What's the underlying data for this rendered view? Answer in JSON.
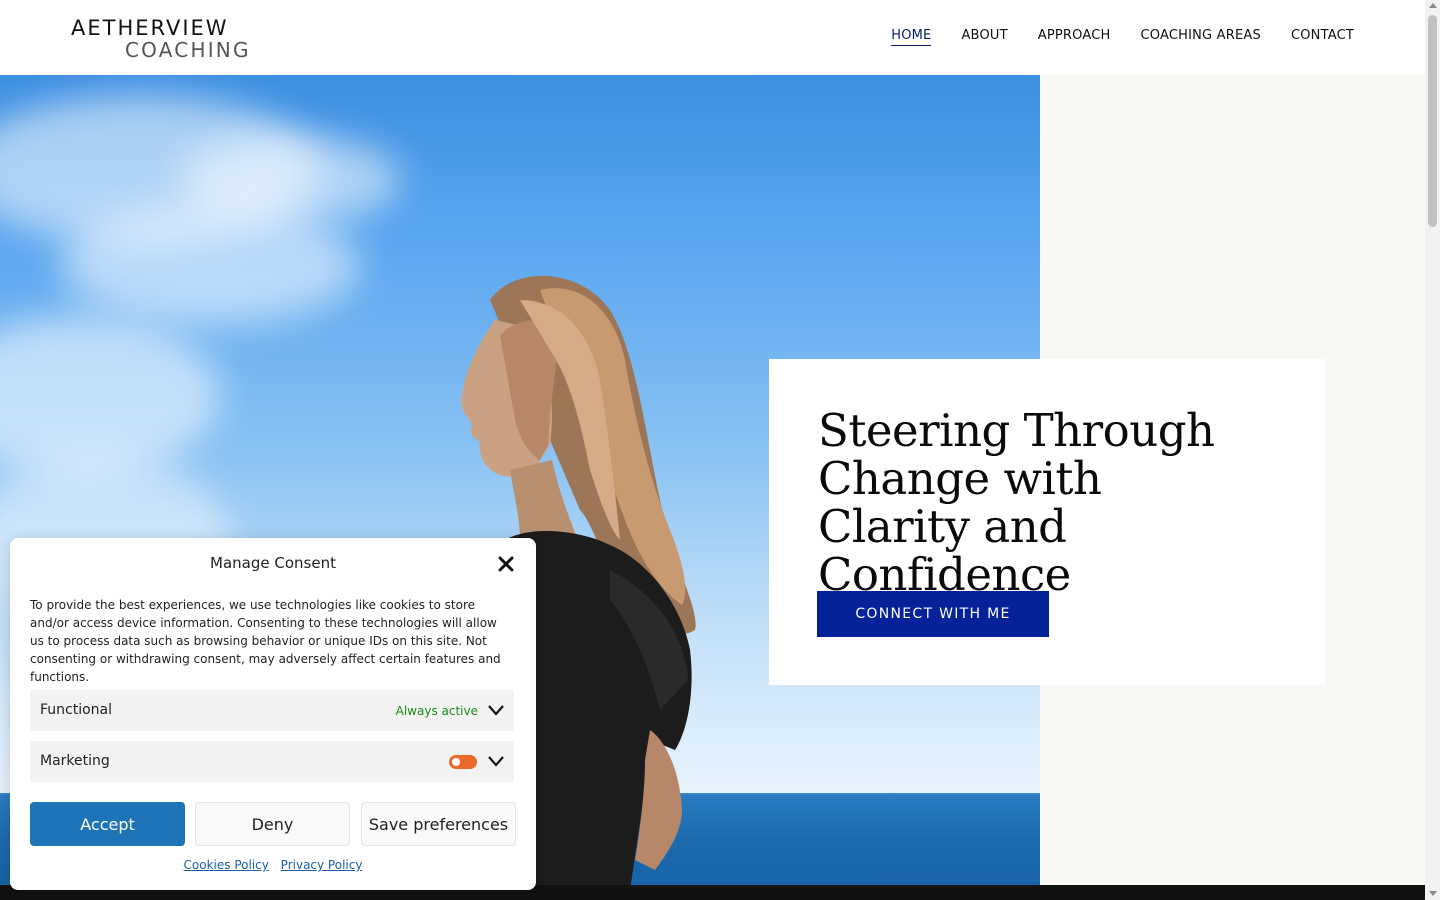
{
  "header": {
    "logo_line1": "AETHERVIEW",
    "logo_line2": "COACHING",
    "nav": [
      {
        "label": "HOME",
        "active": true
      },
      {
        "label": "ABOUT",
        "active": false
      },
      {
        "label": "APPROACH",
        "active": false
      },
      {
        "label": "COACHING AREAS",
        "active": false
      },
      {
        "label": "CONTACT",
        "active": false
      }
    ]
  },
  "hero": {
    "heading": "Steering Through Change with Clarity and Confidence",
    "cta_label": "CONNECT WITH ME",
    "image_alt": "woman-looking-at-sea-icon"
  },
  "consent": {
    "title": "Manage Consent",
    "body": "To provide the best experiences, we use technologies like cookies to store and/or access device information. Consenting to these technologies will allow us to process data such as browsing behavior or unique IDs on this site. Not consenting or withdrawing consent, may adversely affect certain features and functions.",
    "categories": [
      {
        "label": "Functional",
        "status": "Always active"
      },
      {
        "label": "Marketing",
        "toggle": "off"
      }
    ],
    "buttons": {
      "accept": "Accept",
      "deny": "Deny",
      "save": "Save preferences"
    },
    "links": {
      "cookies": "Cookies Policy",
      "privacy": "Privacy Policy"
    }
  },
  "colors": {
    "primary": "#062299",
    "accept": "#1f73b7",
    "toggle": "#e96a2b",
    "status": "#1a8a1a"
  }
}
